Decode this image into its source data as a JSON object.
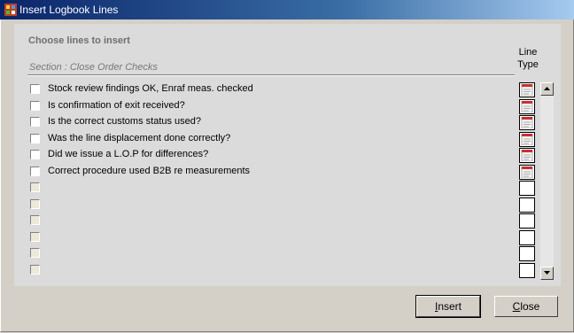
{
  "window": {
    "title": "Insert Logbook Lines"
  },
  "panel": {
    "heading": "Choose lines to insert",
    "section": "Section : Close Order Checks",
    "column_header_line1": "Line",
    "column_header_line2": "Type"
  },
  "rows": [
    {
      "text": "Stock review findings OK, Enraf meas. checked",
      "has_icon": true
    },
    {
      "text": "Is confirmation of exit received?",
      "has_icon": true
    },
    {
      "text": "Is the correct customs status used?",
      "has_icon": true
    },
    {
      "text": "Was the line displacement done correctly?",
      "has_icon": true
    },
    {
      "text": "Did we issue a L.O.P for differences?",
      "has_icon": true
    },
    {
      "text": "Correct procedure used B2B re measurements",
      "has_icon": true
    },
    {
      "text": "",
      "has_icon": false
    },
    {
      "text": "",
      "has_icon": false
    },
    {
      "text": "",
      "has_icon": false
    },
    {
      "text": "",
      "has_icon": false
    },
    {
      "text": "",
      "has_icon": false
    },
    {
      "text": "",
      "has_icon": false
    }
  ],
  "buttons": {
    "insert_first": "I",
    "insert_rest": "nsert",
    "close_first": "C",
    "close_rest": "lose"
  }
}
